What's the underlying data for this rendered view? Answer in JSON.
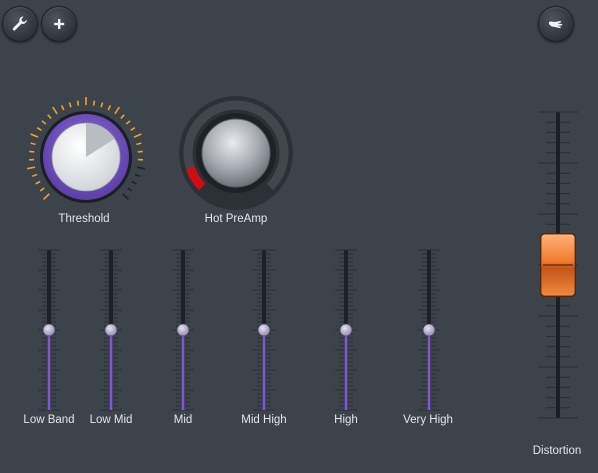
{
  "toolbar": {
    "left_buttons": [
      {
        "icon": "wrench-icon"
      },
      {
        "icon": "plus-icon"
      }
    ],
    "right_button": {
      "icon": "hand-pointer-icon"
    }
  },
  "knobs": [
    {
      "label": "Threshold",
      "value": 0.32,
      "accent": "#5b3ea6",
      "tick_color": "#f0a030"
    },
    {
      "label": "Hot PreAmp",
      "value": 0.1,
      "accent": "#d40b12"
    }
  ],
  "faders": [
    {
      "label": "Low Band",
      "value": 0.5
    },
    {
      "label": "Low Mid",
      "value": 0.5
    },
    {
      "label": "Mid",
      "value": 0.5
    },
    {
      "label": "Mid High",
      "value": 0.5
    },
    {
      "label": "High",
      "value": 0.5
    },
    {
      "label": "Very High",
      "value": 0.5
    }
  ],
  "distortion": {
    "label": "Distortion",
    "value": 0.5,
    "color": "#f07a2c"
  },
  "colors": {
    "fader_fill": "#7a5cc4",
    "background": "#3d434a"
  }
}
